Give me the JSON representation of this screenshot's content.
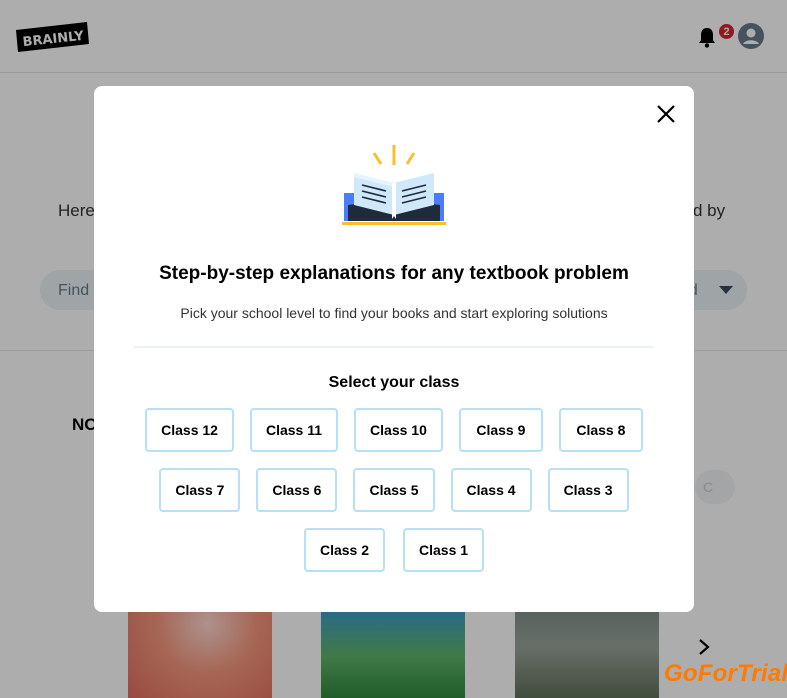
{
  "header": {
    "logo_text": "BRAINLY",
    "notification_count": "2",
    "icons": {
      "notifications": "bell-icon",
      "profile": "user-avatar-icon"
    }
  },
  "background": {
    "intro_left": "Here",
    "intro_right": "d by",
    "search_placeholder": "Find a",
    "dropdown_fragment": "ed",
    "section_label": "NO",
    "ghost_chip_text": "C"
  },
  "modal": {
    "title": "Step-by-step explanations for any textbook problem",
    "subtitle": "Pick your school level to find your books and start exploring solutions",
    "select_label": "Select your class",
    "class_rows": [
      [
        "Class 12",
        "Class 11",
        "Class 10",
        "Class 9",
        "Class 8"
      ],
      [
        "Class 7",
        "Class 6",
        "Class 5",
        "Class 4",
        "Class 3"
      ],
      [
        "Class 2",
        "Class 1"
      ]
    ],
    "colors": {
      "button_border": "#b7e0f7",
      "illustration_blue": "#4a7cff",
      "illustration_yellow": "#fbbe2e"
    },
    "icons": {
      "close": "close-icon",
      "illustration": "open-book-icon"
    }
  },
  "watermark": "GoForTrial"
}
